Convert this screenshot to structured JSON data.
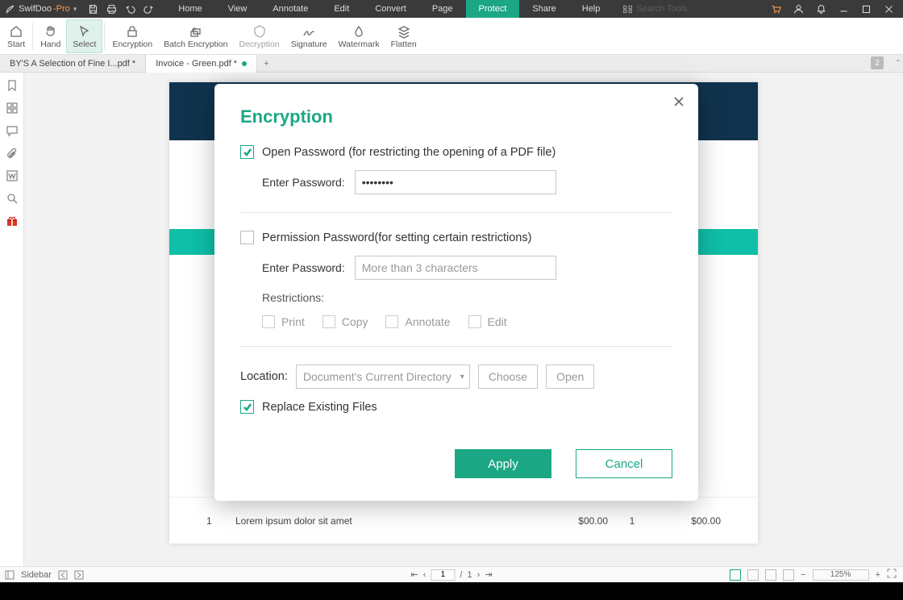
{
  "title": {
    "brand1": "SwifDoo",
    "brand2": "-Pro"
  },
  "menu": {
    "home": "Home",
    "view": "View",
    "annotate": "Annotate",
    "edit": "Edit",
    "convert": "Convert",
    "page": "Page",
    "protect": "Protect",
    "share": "Share",
    "help": "Help"
  },
  "search": {
    "placeholder": "Search Tools"
  },
  "ribbon": {
    "start": "Start",
    "hand": "Hand",
    "select": "Select",
    "encryption": "Encryption",
    "batch": "Batch Encryption",
    "decryption": "Decryption",
    "signature": "Signature",
    "watermark": "Watermark",
    "flatten": "Flatten"
  },
  "tabs": {
    "t1": "BY'S A Selection of Fine I...pdf *",
    "t2": "Invoice - Green.pdf *",
    "badge": "2"
  },
  "doc": {
    "row_index": "1",
    "row_desc": "Lorem ipsum dolor sit amet",
    "row_price": "$00.00",
    "row_qty": "1",
    "row_total": "$00.00"
  },
  "modal": {
    "title": "Encryption",
    "open_pw_label": "Open Password (for restricting the opening of a PDF file)",
    "enter_pw": "Enter Password:",
    "open_pw_value": "********",
    "perm_pw_label": "Permission Password(for setting certain restrictions)",
    "perm_pw_placeholder": "More than 3 characters",
    "restrictions": "Restrictions:",
    "r_print": "Print",
    "r_copy": "Copy",
    "r_annotate": "Annotate",
    "r_edit": "Edit",
    "location": "Location:",
    "loc_sel": "Document's Current Directory",
    "choose": "Choose",
    "open": "Open",
    "replace": "Replace Existing Files",
    "apply": "Apply",
    "cancel": "Cancel"
  },
  "status": {
    "sidebar": "Sidebar",
    "page_cur": "1",
    "page_sep": "/",
    "page_tot": "1",
    "zoom": "125%"
  }
}
